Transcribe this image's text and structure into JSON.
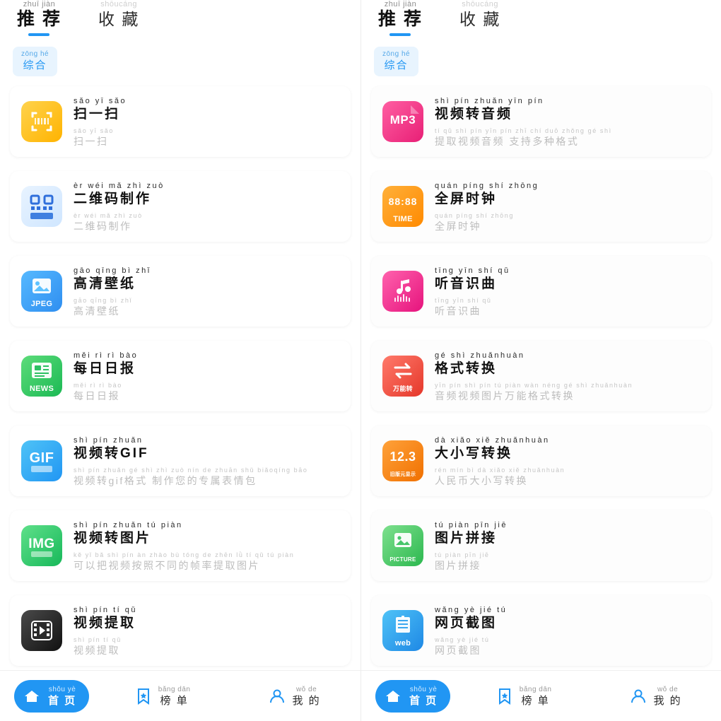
{
  "tabs": [
    {
      "py": "zhuī jiàn",
      "han": "推 荐",
      "active": true
    },
    {
      "py": "shōucáng",
      "han": "收 藏",
      "active": false
    }
  ],
  "chip": {
    "py": "zōng hé",
    "han": "综合"
  },
  "left_list": [
    {
      "icon": "scan-icon",
      "icon_label": "",
      "py_top": "sǎo yī sǎo",
      "title": "扫一扫",
      "py_sub": "sǎo yī sǎo",
      "sub": "扫一扫"
    },
    {
      "icon": "qrcode-icon",
      "icon_label": "",
      "py_top": "èr wéi mǎ zhì zuò",
      "title": "二维码制作",
      "py_sub": "èr wéi mǎ zhì zuò",
      "sub": "二维码制作"
    },
    {
      "icon": "jpeg-icon",
      "icon_label": "JPEG",
      "py_top": "gāo qīng bì zhǐ",
      "title": "高清壁纸",
      "py_sub": "gāo qīng bì zhǐ",
      "sub": "高清壁纸"
    },
    {
      "icon": "news-icon",
      "icon_label": "NEWS",
      "py_top": "měi rì rì bào",
      "title": "每日日报",
      "py_sub": "měi rì rì bào",
      "sub": "每日日报"
    },
    {
      "icon": "gif-icon",
      "icon_label": "GIF",
      "py_top": "shì pín zhuǎn",
      "title": "视频转GIF",
      "py_sub": "shì pín zhuǎn gé shì zhì zuò nín de zhuān shǔ biǎoqíng bāo",
      "sub": "视频转gif格式 制作您的专属表情包"
    },
    {
      "icon": "img-icon",
      "icon_label": "IMG",
      "py_top": "shì pín zhuǎn tú piàn",
      "title": "视频转图片",
      "py_sub": "kě yǐ bǎ shì pín àn zhào bù tóng de zhēn lǜ tí qǔ tú piàn",
      "sub": "可以把视频按照不同的帧率提取图片"
    },
    {
      "icon": "video-extract-icon",
      "icon_label": "",
      "py_top": "shì pín tí qǔ",
      "title": "视频提取",
      "py_sub": "shì pín tí qǔ",
      "sub": "视频提取"
    }
  ],
  "right_list": [
    {
      "icon": "mp3-icon",
      "icon_label": "MP3",
      "py_top": "shì pín zhuǎn yīn pín",
      "title": "视频转音频",
      "py_sub": "tí qǔ shì pín yīn pín  zhī chí duō zhǒng gé shì",
      "sub": "提取视频音频 支持多种格式"
    },
    {
      "icon": "clock-icon",
      "icon_label": "TIME",
      "py_top": "quán píng shí zhōng",
      "title": "全屏时钟",
      "py_sub": "quán píng shí zhōng",
      "sub": "全屏时钟"
    },
    {
      "icon": "music-icon",
      "icon_label": "",
      "py_top": "tīng yīn shí qǔ",
      "title": "听音识曲",
      "py_sub": "tīng yīn shí qǔ",
      "sub": "听音识曲"
    },
    {
      "icon": "convert-icon",
      "icon_label": "万能转",
      "py_top": "gé shì zhuǎnhuàn",
      "title": "格式转换",
      "py_sub": "yīn pín shì pín tú piàn wàn néng gé shì zhuǎnhuàn",
      "sub": "音频视频图片万能格式转换"
    },
    {
      "icon": "case-convert-icon",
      "icon_label": "旧版元显示",
      "icon_big": "12.3",
      "py_top": "dà xiǎo xiě zhuǎnhuàn",
      "title": "大小写转换",
      "py_sub": "rén mín bì dà xiǎo xiě zhuǎnhuàn",
      "sub": "人民币大小写转换"
    },
    {
      "icon": "picture-icon",
      "icon_label": "PICTURE",
      "py_top": "tú piàn pīn jiē",
      "title": "图片拼接",
      "py_sub": "tú piàn pīn jiē",
      "sub": "图片拼接"
    },
    {
      "icon": "web-icon",
      "icon_label": "web",
      "py_top": "wǎng yè jié tú",
      "title": "网页截图",
      "py_sub": "wǎng yè jié tú",
      "sub": "网页截图"
    }
  ],
  "bottom_nav": [
    {
      "icon": "home-icon",
      "py": "shǒu yè",
      "han": "首 页",
      "active": true
    },
    {
      "icon": "ranking-icon",
      "py": "bǎng dān",
      "han": "榜 单",
      "active": false
    },
    {
      "icon": "user-icon",
      "py": "wǒ de",
      "han": "我 的",
      "active": false
    }
  ],
  "colors": {
    "accent": "#2196f3",
    "chip_bg": "#e8f4fe",
    "muted": "#bdbdbd"
  }
}
